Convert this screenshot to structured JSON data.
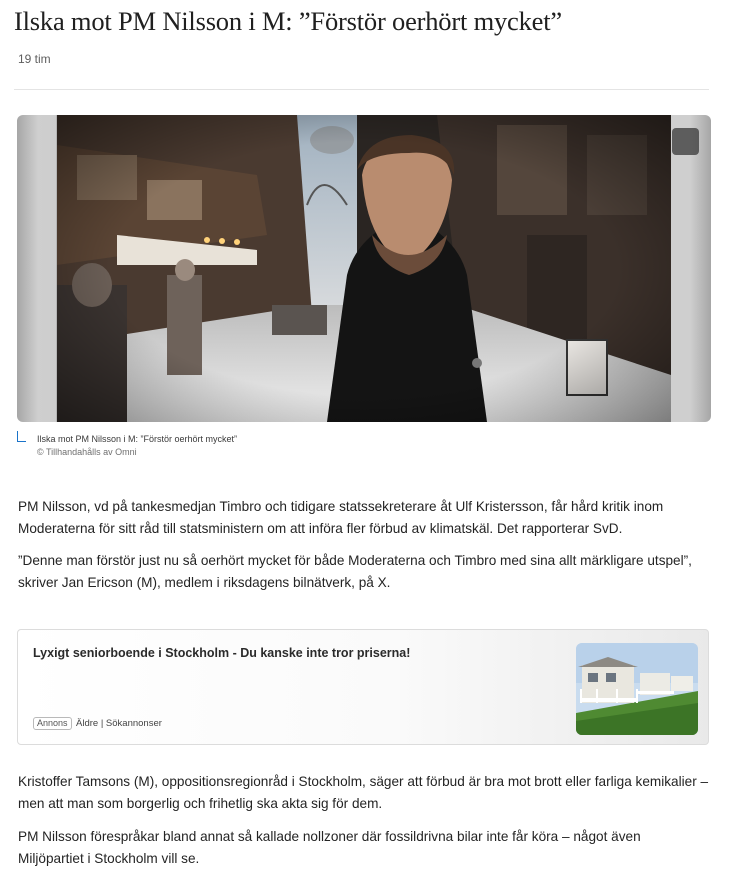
{
  "article": {
    "title": "Ilska mot PM Nilsson i M: ”Förstör oerhört mycket”",
    "timestamp": "19 tim",
    "image": {
      "caption": "Ilska mot PM Nilsson i M: ”Förstör oerhört mycket”",
      "credit": "© Tillhandahålls av Omni",
      "expand_icon": "expand-icon"
    },
    "paragraphs": [
      "PM Nilsson, vd på tankesmedjan Timbro och tidigare statssekreterare åt Ulf Kristersson, får hård kritik inom Moderaterna för sitt råd till statsministern om att införa fler förbud av klimatskäl. Det rapporterar SvD.",
      "”Denne man förstör just nu så oerhört mycket för både Moderaterna och Timbro med sina allt märkligare utspel”, skriver Jan Ericson (M), medlem i riksdagens bilnätverk, på X.",
      "Kristoffer Tamsons (M), oppositionsregionråd i Stockholm, säger att förbud är bra mot brott eller farliga kemikalier – men att man som borgerlig och frihetlig ska akta sig för dem.",
      "PM Nilsson förespråkar bland annat så kallade nollzoner där fossildrivna bilar inte får köra – något även Miljöpartiet i Stockholm vill se."
    ]
  },
  "ad": {
    "title": "Lyxigt seniorboende i Stockholm - Du kanske inte tror priserna!",
    "badge": "Annons",
    "sponsor": "Äldre | Sökannonser"
  },
  "colors": {
    "accent": "#1a73c9",
    "text": "#242424",
    "muted": "#5e5e5e"
  }
}
